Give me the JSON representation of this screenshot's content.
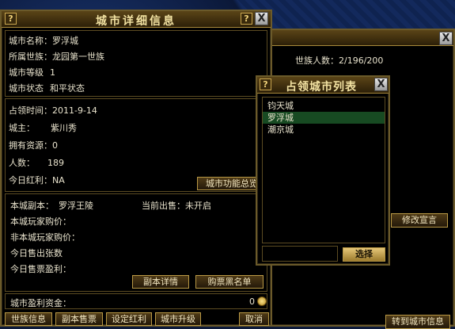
{
  "city_detail": {
    "title": "城市详细信息",
    "help": "?",
    "close": "X",
    "basic": [
      {
        "label": "城市名称：",
        "value": "罗浮城"
      },
      {
        "label": "所属世族：",
        "value": "龙园第一世族"
      },
      {
        "label": "城市等级",
        "value": "1"
      },
      {
        "label": "城市状态",
        "value": "和平状态"
      }
    ],
    "info": [
      {
        "label": "占领时间：",
        "value": "2011-9-14"
      },
      {
        "label": "城主：",
        "value": "紫川秀"
      },
      {
        "label": "拥有资源：",
        "value": "0"
      },
      {
        "label": "人数：",
        "value": "189"
      },
      {
        "label": "今日红利：",
        "value": "NA"
      }
    ],
    "func_button": "城市功能总览",
    "dungeon_label": "本城副本：",
    "dungeon_value": "罗浮王陵",
    "sale_label": "当前出售：",
    "sale_value": "未开启",
    "price_rows": [
      "本城玩家购价：",
      "非本城玩家购价：",
      "今日售出张数",
      "今日售票盈利："
    ],
    "dungeon_detail_button": "副本详情",
    "blacklist_button": "购票黑名单",
    "profit_label": "城市盈利资金：",
    "profit_value": "0",
    "bottom_buttons": [
      "世族信息",
      "副本售票",
      "设定红利",
      "城市升级"
    ],
    "cancel": "取消"
  },
  "clan_panel": {
    "close": "X",
    "members_label": "世族人数：",
    "members_value": "2/196/200",
    "edit_button": "修改宣言",
    "goto_button": "转到城市信息"
  },
  "city_list": {
    "title": "占领城市列表",
    "help": "?",
    "close": "X",
    "items": [
      "钧天城",
      "罗浮城",
      "潮京城"
    ],
    "selected_index": 1,
    "select_button": "选择"
  }
}
